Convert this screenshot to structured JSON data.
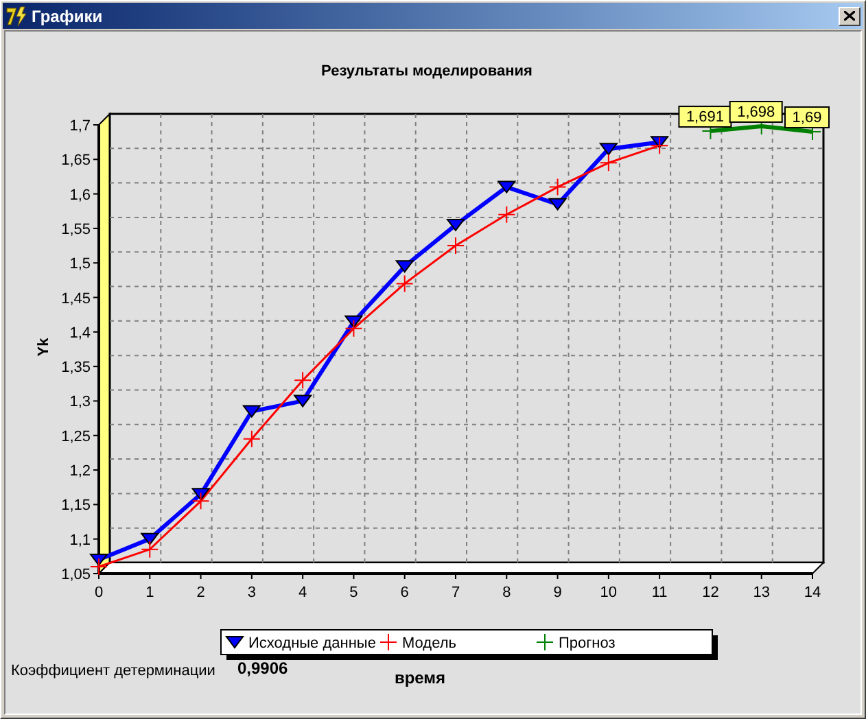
{
  "window": {
    "title": "Графики"
  },
  "chart": {
    "chart_data": {
      "type": "line",
      "title": "Результаты моделирования",
      "xlabel": "время",
      "ylabel": "Yk",
      "x": [
        0,
        1,
        2,
        3,
        4,
        5,
        6,
        7,
        8,
        9,
        10,
        11,
        12,
        13,
        14
      ],
      "legend": true,
      "xlim": [
        0,
        14
      ],
      "ylim": [
        1.05,
        1.7
      ],
      "xticks": [
        0,
        1,
        2,
        3,
        4,
        5,
        6,
        7,
        8,
        9,
        10,
        11,
        12,
        13,
        14
      ],
      "yticks": [
        {
          "value": 1.05,
          "label": "1,05"
        },
        {
          "value": 1.1,
          "label": "1,1"
        },
        {
          "value": 1.15,
          "label": "1,15"
        },
        {
          "value": 1.2,
          "label": "1,2"
        },
        {
          "value": 1.25,
          "label": "1,25"
        },
        {
          "value": 1.3,
          "label": "1,3"
        },
        {
          "value": 1.35,
          "label": "1,35"
        },
        {
          "value": 1.4,
          "label": "1,4"
        },
        {
          "value": 1.45,
          "label": "1,45"
        },
        {
          "value": 1.5,
          "label": "1,5"
        },
        {
          "value": 1.55,
          "label": "1,55"
        },
        {
          "value": 1.6,
          "label": "1,6"
        },
        {
          "value": 1.65,
          "label": "1,65"
        },
        {
          "value": 1.7,
          "label": "1,7"
        }
      ],
      "series": [
        {
          "name": "Исходные данные",
          "color": "#0000ff",
          "marker": "triangle-down",
          "values": [
            1.07,
            1.1,
            1.165,
            1.285,
            1.3,
            1.415,
            1.495,
            1.555,
            1.61,
            1.585,
            1.665,
            1.675,
            null,
            null,
            null
          ]
        },
        {
          "name": "Модель",
          "color": "#ff0000",
          "marker": "cross",
          "values": [
            1.06,
            1.085,
            1.155,
            1.245,
            1.33,
            1.405,
            1.47,
            1.525,
            1.57,
            1.61,
            1.645,
            1.67,
            null,
            null,
            null
          ]
        },
        {
          "name": "Прогноз",
          "color": "#008000",
          "marker": "cross",
          "values": [
            null,
            null,
            null,
            null,
            null,
            null,
            null,
            null,
            null,
            null,
            null,
            null,
            1.691,
            1.698,
            1.69
          ]
        }
      ],
      "annotations": [
        {
          "x": 12,
          "y": 1.691,
          "text": "1,691"
        },
        {
          "x": 13,
          "y": 1.698,
          "text": "1,698"
        },
        {
          "x": 14,
          "y": 1.69,
          "text": "1,69"
        }
      ]
    }
  },
  "footer": {
    "label": "Коэффициент детерминации",
    "value": "0,9906"
  }
}
